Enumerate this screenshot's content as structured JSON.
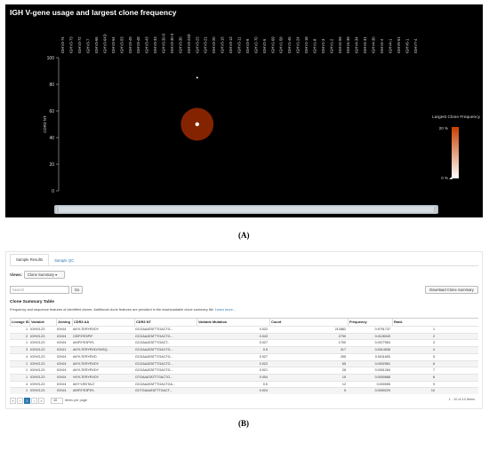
{
  "panel_a": {
    "title": "IGH V-gene usage and largest clone frequency",
    "y_axis_label": "CDR3 NT",
    "y_ticks": [
      "100",
      "80",
      "60",
      "40",
      "20",
      "0"
    ],
    "genes": [
      "IGHV3-74",
      "IGHV3-73",
      "IGHV3-72",
      "IGHV3-7",
      "IGHV3-66",
      "IGHV3-64D",
      "IGHV3-64",
      "IGHV3-53",
      "IGHV3-49",
      "IGHV3-48",
      "IGHV3-43",
      "IGHV3-33",
      "IGHV3-30-5",
      "IGHV3-30-3",
      "IGHV3-30",
      "IGHV3-23D",
      "IGHV3-23",
      "IGHV3-21",
      "IGHV3-20",
      "IGHV3-15",
      "IGHV3-13",
      "IGHV3-11",
      "IGHV3-9",
      "IGHV2-70",
      "IGHV2-5",
      "IGHV1-69",
      "IGHV1-58",
      "IGHV1-46",
      "IGHV1-24",
      "IGHV1-18",
      "IGHV1-8",
      "IGHV1-3",
      "IGHV1-2",
      "IGHV4-59",
      "IGHV4-39",
      "IGHV4-34",
      "IGHV4-31",
      "IGHV4-30",
      "IGHV4-4",
      "IGHV4-1",
      "IGHV5-51",
      "IGHV6-1",
      "IGHV7-4"
    ],
    "legend": {
      "title": "Largest Clone Frequency",
      "top_label": "20 %",
      "bottom_label": "0 %"
    },
    "colors": {
      "background": "#000000",
      "bubble": "#8b2500",
      "bubble_center": "#ffffff",
      "legend_top": "#c84000",
      "legend_bottom": "#ffffff"
    },
    "bubbles": [
      {
        "gene": "IGHV3-23",
        "cdr3_nt": 50,
        "frequency_pct": 17
      },
      {
        "gene": "IGHV3-23",
        "cdr3_nt": 85,
        "frequency_pct": 0.5
      }
    ]
  },
  "panel_b": {
    "tabs": [
      {
        "label": "Sample Results",
        "active": true
      },
      {
        "label": "Sample QC",
        "active": false
      }
    ],
    "views_label": "Views:",
    "views_value": "Clone Summary ▾",
    "search_placeholder": "Search",
    "go_label": "Go",
    "download_label": "Download Clone Summary",
    "summary_title": "Clone Summary Table",
    "summary_desc": "Frequency and sequence features of identified clones. Additional clone features are provided in the downloadable clone summary file.",
    "learn_more": "Learn more...",
    "columns": [
      "Lineage ID",
      "Variable",
      "Joining",
      "CDR3 AA",
      "CDR3 NT",
      "Variable Mutation",
      "Count",
      "Frequency",
      "Rank"
    ],
    "rows": [
      [
        "1",
        "IGHV3-23",
        "IGHJ4",
        "AKYLTERYRVDY",
        "GCGAAATATTTGACTG...",
        "0.022",
        "212882",
        "0.9791737",
        "1"
      ],
      [
        "2",
        "IGHV3-23",
        "IGHJ4",
        "CEIP2*E3P0*",
        "GCGAAATATTTGACTG...",
        "0.043",
        "2790",
        "0.0128349",
        "2"
      ],
      [
        "1",
        "IGHV3-23",
        "IGHJ4",
        "AKIP2*E3P0*L",
        "GCGAAATATTTGACT...",
        "0.027",
        "1700",
        "0.0077954",
        "3"
      ],
      [
        "3",
        "IGHV3-23",
        "IGHJ1",
        "AKYLTERYRVDYWGQ...",
        "GCGAAATATTTGACTG...",
        "0.5",
        "317",
        "0.0014538",
        "4"
      ],
      [
        "4",
        "IGHV3-23",
        "IGHJ4",
        "AKYLTERYRVD",
        "GCGAAATATTTGACTG...",
        "0.027",
        "255",
        "0.0011693",
        "5"
      ],
      [
        "1",
        "IGHV3-23",
        "IGHJ4",
        "AKYLTERYRVDY",
        "GCGAAATATTTGACTG...",
        "0.022",
        "65",
        "0.0002981",
        "6"
      ],
      [
        "1",
        "IGHV3-23",
        "IGHJ4",
        "AKYLTERYRVDY",
        "GCGAAATATTTGACTG...",
        "0.021",
        "28",
        "0.0001284",
        "7"
      ],
      [
        "1",
        "IGHV3-23",
        "IGHJ4",
        "VKYLTERYRVDY",
        "GTGAAATATTTGACTG...",
        "0.054",
        "15",
        "0.0000688",
        "8"
      ],
      [
        "4",
        "IGHV3-23",
        "IGHJ4",
        "AKY*LRDTALT",
        "GCGAAATATTTGACTGA...",
        "0.5",
        "12",
        "0.000055",
        "9"
      ],
      [
        "1",
        "IGHV3-23",
        "IGHJ4",
        "AEIP2*E3P0*L",
        "GCTGAAATATTTGACT...",
        "0.024",
        "5",
        "0.0000229",
        "10"
      ]
    ],
    "pager": {
      "first": "«",
      "prev": "‹",
      "current": "1",
      "next": "›",
      "last": "»",
      "per_page": "10",
      "per_page_label": "items per page",
      "range": "1 - 10 of 10 items"
    }
  },
  "figure_labels": {
    "a": "(A)",
    "b": "(B)"
  }
}
